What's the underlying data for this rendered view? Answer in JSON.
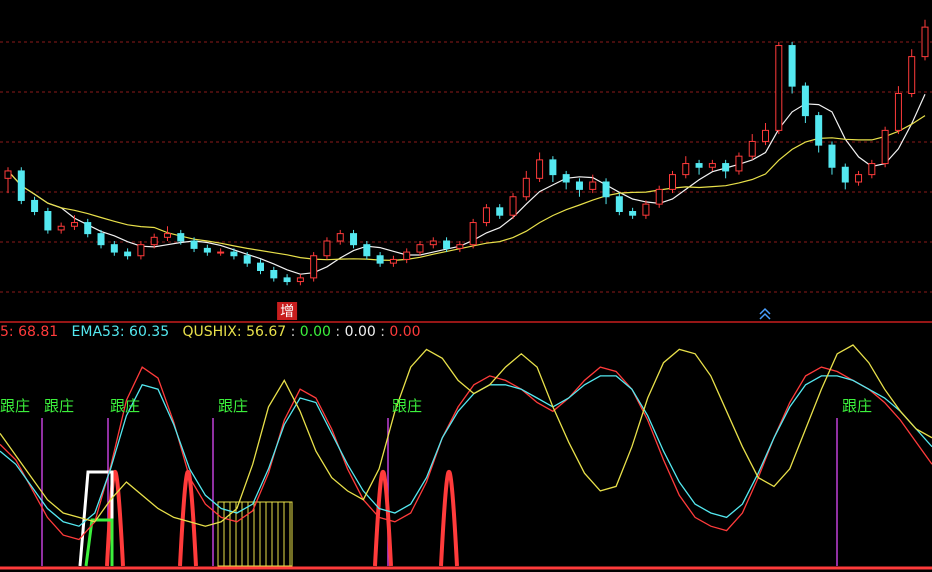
{
  "colors": {
    "up": "#ff3b3b",
    "down": "#54e8f0",
    "ma_white": "#f2f2f2",
    "ma_yellow": "#e8e04a",
    "grid": "#8b1a1a",
    "divider": "#c81e1e",
    "green_label": "#3cf03c",
    "purple": "#c040d8"
  },
  "legend": {
    "item1_label": "5",
    "item1_value": "68.81",
    "item2_label": "EMA53",
    "item2_value": "60.35",
    "item3_label": "QUSHIX",
    "item3_value": "56.67",
    "item4_value": "0.00",
    "item5_value": "0.00",
    "item6_value": "0.00"
  },
  "main_annotation": "增",
  "signal_label": "跟庄",
  "chart_data": [
    {
      "type": "candlestick",
      "panel": "price",
      "series": [
        {
          "name": "candles",
          "bars": [
            [
              3.3,
              3.5,
              3.6,
              2.9
            ],
            [
              3.5,
              2.7,
              3.6,
              2.6
            ],
            [
              2.7,
              2.4,
              2.8,
              2.3
            ],
            [
              2.4,
              1.9,
              2.5,
              1.8
            ],
            [
              1.9,
              2.0,
              2.1,
              1.8
            ],
            [
              2.0,
              2.1,
              2.3,
              1.9
            ],
            [
              2.1,
              1.8,
              2.2,
              1.7
            ],
            [
              1.8,
              1.5,
              1.9,
              1.4
            ],
            [
              1.5,
              1.3,
              1.6,
              1.2
            ],
            [
              1.3,
              1.2,
              1.4,
              1.1
            ],
            [
              1.2,
              1.5,
              1.6,
              1.1
            ],
            [
              1.5,
              1.7,
              1.8,
              1.4
            ],
            [
              1.7,
              1.8,
              2.0,
              1.6
            ],
            [
              1.8,
              1.6,
              1.9,
              1.5
            ],
            [
              1.6,
              1.4,
              1.7,
              1.3
            ],
            [
              1.4,
              1.3,
              1.5,
              1.2
            ],
            [
              1.3,
              1.3,
              1.4,
              1.2
            ],
            [
              1.3,
              1.2,
              1.4,
              1.1
            ],
            [
              1.2,
              1.0,
              1.3,
              0.9
            ],
            [
              1.0,
              0.8,
              1.1,
              0.7
            ],
            [
              0.8,
              0.6,
              0.9,
              0.5
            ],
            [
              0.6,
              0.5,
              0.7,
              0.4
            ],
            [
              0.5,
              0.6,
              0.7,
              0.4
            ],
            [
              0.6,
              1.2,
              1.3,
              0.5
            ],
            [
              1.2,
              1.6,
              1.7,
              1.1
            ],
            [
              1.6,
              1.8,
              1.9,
              1.5
            ],
            [
              1.8,
              1.5,
              1.9,
              1.4
            ],
            [
              1.5,
              1.2,
              1.6,
              1.1
            ],
            [
              1.2,
              1.0,
              1.3,
              0.9
            ],
            [
              1.0,
              1.1,
              1.2,
              0.9
            ],
            [
              1.1,
              1.3,
              1.4,
              1.0
            ],
            [
              1.3,
              1.5,
              1.6,
              1.2
            ],
            [
              1.5,
              1.6,
              1.7,
              1.4
            ],
            [
              1.6,
              1.4,
              1.7,
              1.3
            ],
            [
              1.4,
              1.5,
              1.6,
              1.3
            ],
            [
              1.5,
              2.1,
              2.2,
              1.4
            ],
            [
              2.1,
              2.5,
              2.6,
              2.0
            ],
            [
              2.5,
              2.3,
              2.6,
              2.2
            ],
            [
              2.3,
              2.8,
              2.9,
              2.2
            ],
            [
              2.8,
              3.3,
              3.5,
              2.7
            ],
            [
              3.3,
              3.8,
              4.0,
              3.2
            ],
            [
              3.8,
              3.4,
              3.9,
              3.2
            ],
            [
              3.4,
              3.2,
              3.5,
              3.0
            ],
            [
              3.2,
              3.0,
              3.3,
              2.8
            ],
            [
              3.0,
              3.2,
              3.4,
              2.9
            ],
            [
              3.2,
              2.8,
              3.3,
              2.6
            ],
            [
              2.8,
              2.4,
              2.9,
              2.3
            ],
            [
              2.4,
              2.3,
              2.5,
              2.2
            ],
            [
              2.3,
              2.6,
              2.7,
              2.2
            ],
            [
              2.6,
              3.0,
              3.1,
              2.5
            ],
            [
              3.0,
              3.4,
              3.5,
              2.9
            ],
            [
              3.4,
              3.7,
              3.9,
              3.3
            ],
            [
              3.7,
              3.6,
              3.8,
              3.4
            ],
            [
              3.6,
              3.7,
              3.8,
              3.5
            ],
            [
              3.7,
              3.5,
              3.8,
              3.3
            ],
            [
              3.5,
              3.9,
              4.0,
              3.4
            ],
            [
              3.9,
              4.3,
              4.5,
              3.8
            ],
            [
              4.3,
              4.6,
              4.8,
              4.2
            ],
            [
              4.6,
              6.9,
              7.0,
              4.5
            ],
            [
              6.9,
              5.8,
              7.0,
              5.6
            ],
            [
              5.8,
              5.0,
              5.9,
              4.8
            ],
            [
              5.0,
              4.2,
              5.1,
              4.0
            ],
            [
              4.2,
              3.6,
              4.3,
              3.4
            ],
            [
              3.6,
              3.2,
              3.7,
              3.0
            ],
            [
              3.2,
              3.4,
              3.5,
              3.1
            ],
            [
              3.4,
              3.7,
              3.8,
              3.3
            ],
            [
              3.7,
              4.6,
              4.7,
              3.6
            ],
            [
              4.6,
              5.6,
              5.8,
              4.5
            ],
            [
              5.6,
              6.6,
              6.8,
              5.5
            ],
            [
              6.6,
              7.4,
              7.6,
              6.5
            ]
          ]
        }
      ]
    },
    {
      "type": "line",
      "panel": "indicator",
      "series": [
        {
          "name": "red",
          "values": [
            55,
            48,
            35,
            22,
            14,
            12,
            20,
            45,
            75,
            90,
            85,
            65,
            40,
            28,
            22,
            20,
            25,
            42,
            66,
            80,
            76,
            62,
            44,
            30,
            22,
            20,
            24,
            38,
            58,
            72,
            82,
            86,
            84,
            80,
            74,
            70,
            76,
            84,
            90,
            88,
            80,
            66,
            48,
            32,
            22,
            18,
            16,
            24,
            40,
            58,
            74,
            86,
            90,
            88,
            84,
            80,
            74,
            66,
            56,
            46
          ]
        },
        {
          "name": "cyan",
          "values": [
            52,
            46,
            36,
            26,
            20,
            18,
            24,
            44,
            68,
            82,
            80,
            64,
            44,
            32,
            26,
            24,
            28,
            44,
            64,
            76,
            74,
            60,
            46,
            34,
            26,
            24,
            28,
            40,
            58,
            70,
            78,
            82,
            82,
            80,
            76,
            72,
            76,
            82,
            86,
            86,
            80,
            68,
            52,
            38,
            28,
            24,
            22,
            28,
            42,
            58,
            72,
            82,
            86,
            86,
            84,
            80,
            76,
            70,
            62,
            54
          ]
        },
        {
          "name": "yellow",
          "values": [
            60,
            50,
            40,
            30,
            24,
            22,
            20,
            30,
            38,
            32,
            26,
            22,
            20,
            18,
            20,
            26,
            46,
            72,
            84,
            70,
            52,
            40,
            34,
            30,
            44,
            70,
            90,
            98,
            94,
            84,
            78,
            82,
            90,
            96,
            90,
            72,
            56,
            42,
            34,
            36,
            54,
            76,
            92,
            98,
            96,
            86,
            70,
            54,
            40,
            36,
            44,
            62,
            80,
            96,
            100,
            92,
            80,
            70,
            62,
            58
          ]
        }
      ]
    }
  ]
}
